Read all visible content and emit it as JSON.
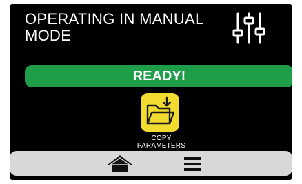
{
  "header": {
    "title": "OPERATING IN MANUAL\nMODE",
    "settings_icon": "sliders-icon"
  },
  "status": {
    "label": "READY!",
    "color": "#1f9e4a"
  },
  "actions": {
    "copy_parameters": {
      "label": "COPY\nPARAMETERS",
      "icon": "folder-download-icon",
      "color": "#f2dc2f"
    }
  },
  "bottom_nav": {
    "home_icon": "home-icon",
    "menu_icon": "hamburger-menu-icon"
  }
}
